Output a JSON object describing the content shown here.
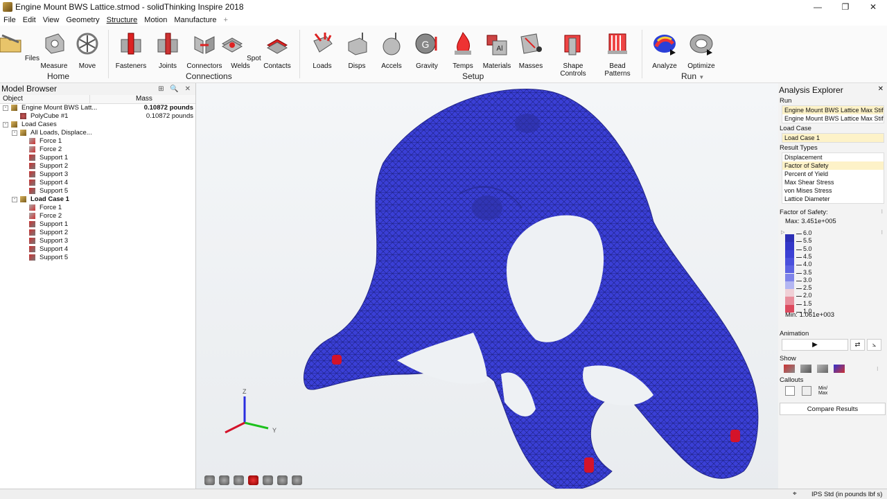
{
  "window": {
    "title": "Engine Mount BWS Lattice.stmod - solidThinking Inspire 2018",
    "controls": [
      "—",
      "❐",
      "✕"
    ]
  },
  "menu": {
    "items": [
      "File",
      "Edit",
      "View",
      "Geometry",
      "Structure",
      "Motion",
      "Manufacture"
    ],
    "active": "Structure",
    "add": "+"
  },
  "ribbon": {
    "buttons": {
      "files": "Files",
      "measure": "Measure",
      "move": "Move",
      "fasteners": "Fasteners",
      "joints": "Joints",
      "connectors": "Connectors",
      "spotwelds": "Spot Welds",
      "contacts": "Contacts",
      "loads": "Loads",
      "disps": "Disps",
      "accels": "Accels",
      "gravity": "Gravity",
      "temps": "Temps",
      "materials": "Materials",
      "masses": "Masses",
      "shapecontrols": "Shape Controls",
      "beadpatterns": "Bead Patterns",
      "analyze": "Analyze",
      "optimize": "Optimize"
    },
    "groups": {
      "home": "Home",
      "connections": "Connections",
      "setup": "Setup",
      "run": "Run"
    },
    "run_arrow": "▼"
  },
  "model_browser": {
    "title": "Model Browser",
    "tools": "⊞ 🔍 ✕",
    "col_object": "Object",
    "col_mass": "Mass",
    "rows": [
      {
        "label": "Engine Mount BWS Latt...",
        "mass": "0.10872 pounds",
        "level": 0,
        "bold_mass": true,
        "tog": "-"
      },
      {
        "label": "PolyCube #1",
        "mass": "0.10872 pounds",
        "level": 1
      },
      {
        "label": "Load Cases",
        "mass": "",
        "level": 0,
        "tog": "-"
      },
      {
        "label": "All Loads, Displace...",
        "mass": "",
        "level": 1,
        "tog": "-"
      },
      {
        "label": "Force 1",
        "mass": "",
        "level": 2
      },
      {
        "label": "Force 2",
        "mass": "",
        "level": 2
      },
      {
        "label": "Support 1",
        "mass": "",
        "level": 2
      },
      {
        "label": "Support 2",
        "mass": "",
        "level": 2
      },
      {
        "label": "Support 3",
        "mass": "",
        "level": 2
      },
      {
        "label": "Support 4",
        "mass": "",
        "level": 2
      },
      {
        "label": "Support 5",
        "mass": "",
        "level": 2
      },
      {
        "label": "Load Case 1",
        "mass": "",
        "level": 1,
        "tog": "-",
        "bold": true
      },
      {
        "label": "Force 1",
        "mass": "",
        "level": 2
      },
      {
        "label": "Force 2",
        "mass": "",
        "level": 2
      },
      {
        "label": "Support 1",
        "mass": "",
        "level": 2
      },
      {
        "label": "Support 2",
        "mass": "",
        "level": 2
      },
      {
        "label": "Support 3",
        "mass": "",
        "level": 2
      },
      {
        "label": "Support 4",
        "mass": "",
        "level": 2
      },
      {
        "label": "Support 5",
        "mass": "",
        "level": 2
      }
    ]
  },
  "viewport": {
    "axis_z": "Z",
    "axis_y": "Y",
    "model_color": "#3a3fd6",
    "support_color": "#d4132a"
  },
  "analysis_explorer": {
    "title": "Analysis Explorer",
    "close": "✕",
    "run_label": "Run",
    "runs": [
      "Engine Mount BWS Lattice Max Stif...",
      "Engine Mount BWS Lattice Max Stif..."
    ],
    "load_case_label": "Load Case",
    "load_case": "Load Case 1",
    "result_types_label": "Result Types",
    "result_types": [
      "Displacement",
      "Factor of Safety",
      "Percent of Yield",
      "Max Shear Stress",
      "von Mises Stress",
      "Lattice Diameter"
    ],
    "selected_result": "Factor of Safety",
    "fos_label": "Factor of Safety:",
    "max": "Max:  3.451e+005",
    "min": "Min:  1.061e+003",
    "legend_values": [
      "6.0",
      "5.5",
      "5.0",
      "4.5",
      "4.0",
      "3.5",
      "3.0",
      "2.5",
      "2.0",
      "1.5",
      "1.0"
    ],
    "legend_colors": [
      "#2c2fb6",
      "#3337c8",
      "#3b40d4",
      "#4a50dc",
      "#5d63e2",
      "#7e83e9",
      "#b3b6f2",
      "#f0d0d6",
      "#e88e9c",
      "#dc4a5e",
      "#cc1428"
    ],
    "animation_label": "Animation",
    "play": "▶",
    "show_label": "Show",
    "callouts_label": "Callouts",
    "minmax": "Min/\nMax",
    "compare": "Compare Results"
  },
  "status": {
    "units": "IPS Std (in pounds lbf s)"
  }
}
